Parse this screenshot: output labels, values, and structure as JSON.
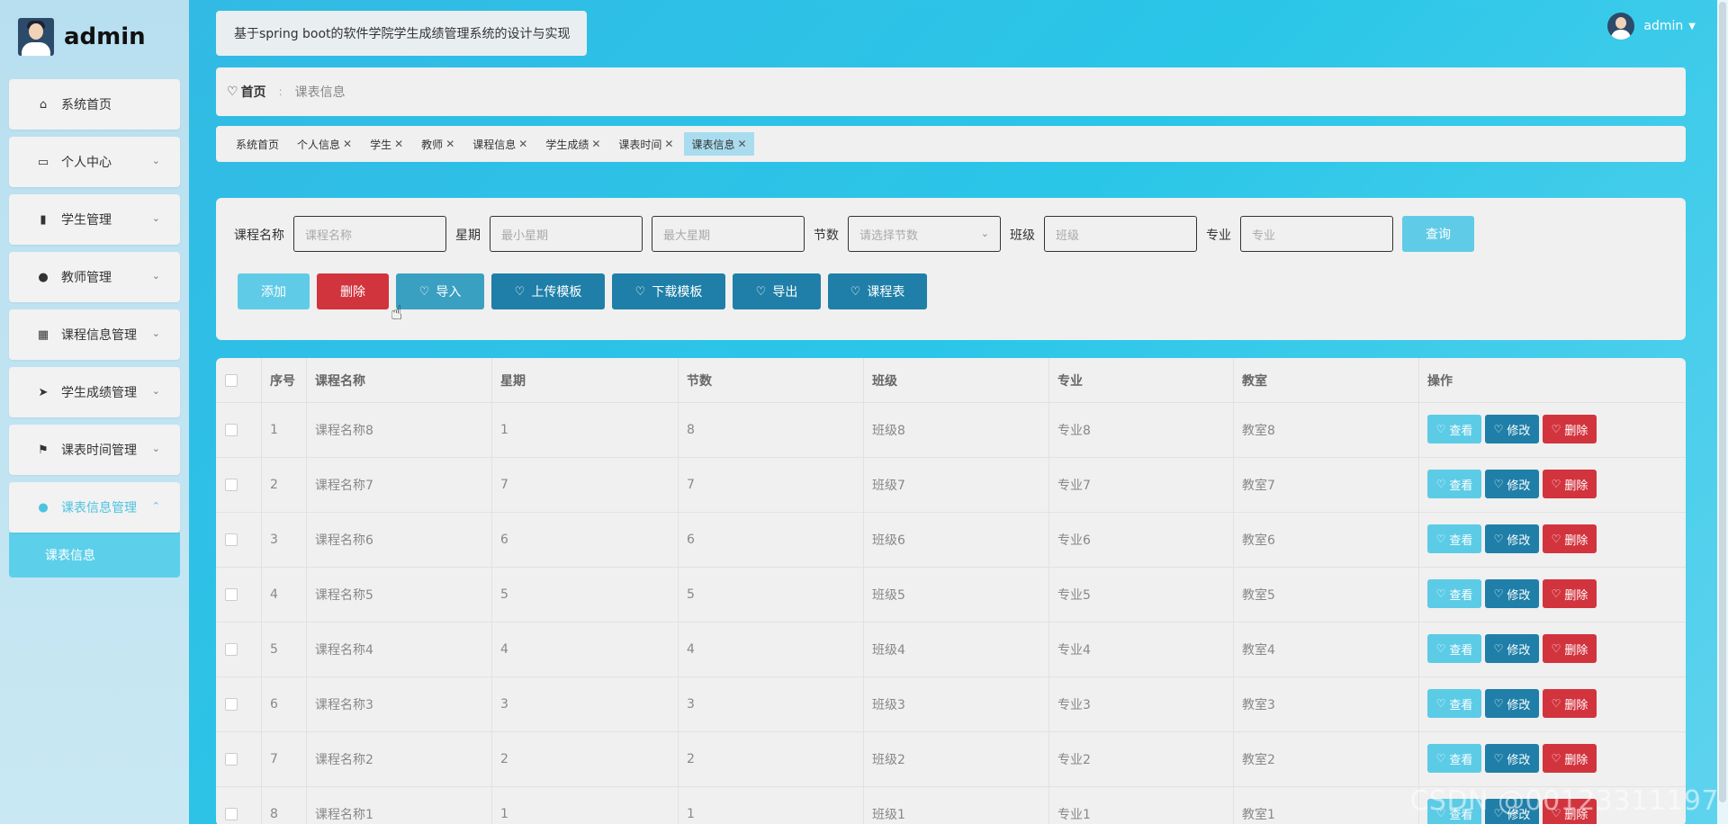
{
  "brand": {
    "title": "admin"
  },
  "header": {
    "title": "基于spring boot的软件学院学生成绩管理系统的设计与实现"
  },
  "user": {
    "name": "admin"
  },
  "sidebar": {
    "items": [
      {
        "label": "系统首页",
        "icon": "home-icon",
        "glyph": "⌂",
        "expandable": false
      },
      {
        "label": "个人中心",
        "icon": "calendar-icon",
        "glyph": "▭",
        "expandable": true
      },
      {
        "label": "学生管理",
        "icon": "books-icon",
        "glyph": "▮",
        "expandable": true
      },
      {
        "label": "教师管理",
        "icon": "user-icon",
        "glyph": "●",
        "expandable": true
      },
      {
        "label": "课程信息管理",
        "icon": "grid-icon",
        "glyph": "▦",
        "expandable": true
      },
      {
        "label": "学生成绩管理",
        "icon": "send-icon",
        "glyph": "➤",
        "expandable": true
      },
      {
        "label": "课表时间管理",
        "icon": "flag-icon",
        "glyph": "⚑",
        "expandable": true
      },
      {
        "label": "课表信息管理",
        "icon": "location-icon",
        "glyph": "●",
        "expandable": true,
        "active": true
      }
    ],
    "sub": {
      "label": "课表信息"
    }
  },
  "breadcrumb": {
    "home": "首页",
    "separator": ":",
    "current": "课表信息"
  },
  "tags": [
    {
      "label": "系统首页",
      "closable": false
    },
    {
      "label": "个人信息",
      "closable": true
    },
    {
      "label": "学生",
      "closable": true
    },
    {
      "label": "教师",
      "closable": true
    },
    {
      "label": "课程信息",
      "closable": true
    },
    {
      "label": "学生成绩",
      "closable": true
    },
    {
      "label": "课表时间",
      "closable": true
    },
    {
      "label": "课表信息",
      "closable": true,
      "active": true
    }
  ],
  "search": {
    "course_label": "课程名称",
    "course_placeholder": "课程名称",
    "week_label": "星期",
    "week_min_placeholder": "最小星期",
    "week_max_placeholder": "最大星期",
    "section_label": "节数",
    "section_placeholder": "请选择节数",
    "class_label": "班级",
    "class_placeholder": "班级",
    "major_label": "专业",
    "major_placeholder": "专业",
    "query_label": "查询"
  },
  "actions": {
    "add": "添加",
    "delete": "删除",
    "import": "导入",
    "upload_template": "上传模板",
    "download_template": "下载模板",
    "export": "导出",
    "schedule": "课程表"
  },
  "table": {
    "headers": [
      "序号",
      "课程名称",
      "星期",
      "节数",
      "班级",
      "专业",
      "教室",
      "操作"
    ],
    "row_actions": {
      "view": "查看",
      "edit": "修改",
      "delete": "删除"
    },
    "rows": [
      [
        "1",
        "课程名称8",
        "1",
        "8",
        "班级8",
        "专业8",
        "教室8"
      ],
      [
        "2",
        "课程名称7",
        "7",
        "7",
        "班级7",
        "专业7",
        "教室7"
      ],
      [
        "3",
        "课程名称6",
        "6",
        "6",
        "班级6",
        "专业6",
        "教室6"
      ],
      [
        "4",
        "课程名称5",
        "5",
        "5",
        "班级5",
        "专业5",
        "教室5"
      ],
      [
        "5",
        "课程名称4",
        "4",
        "4",
        "班级4",
        "专业4",
        "教室4"
      ],
      [
        "6",
        "课程名称3",
        "3",
        "3",
        "班级3",
        "专业3",
        "教室3"
      ],
      [
        "7",
        "课程名称2",
        "2",
        "2",
        "班级2",
        "专业2",
        "教室2"
      ],
      [
        "8",
        "课程名称1",
        "1",
        "1",
        "班级1",
        "专业1",
        "教室1"
      ]
    ]
  },
  "watermark": "CSDN @00123311197",
  "colors": {
    "accent": "#2ac6e8",
    "primary": "#1f7fa8",
    "danger": "#d2343e",
    "light": "#60cbe6"
  }
}
